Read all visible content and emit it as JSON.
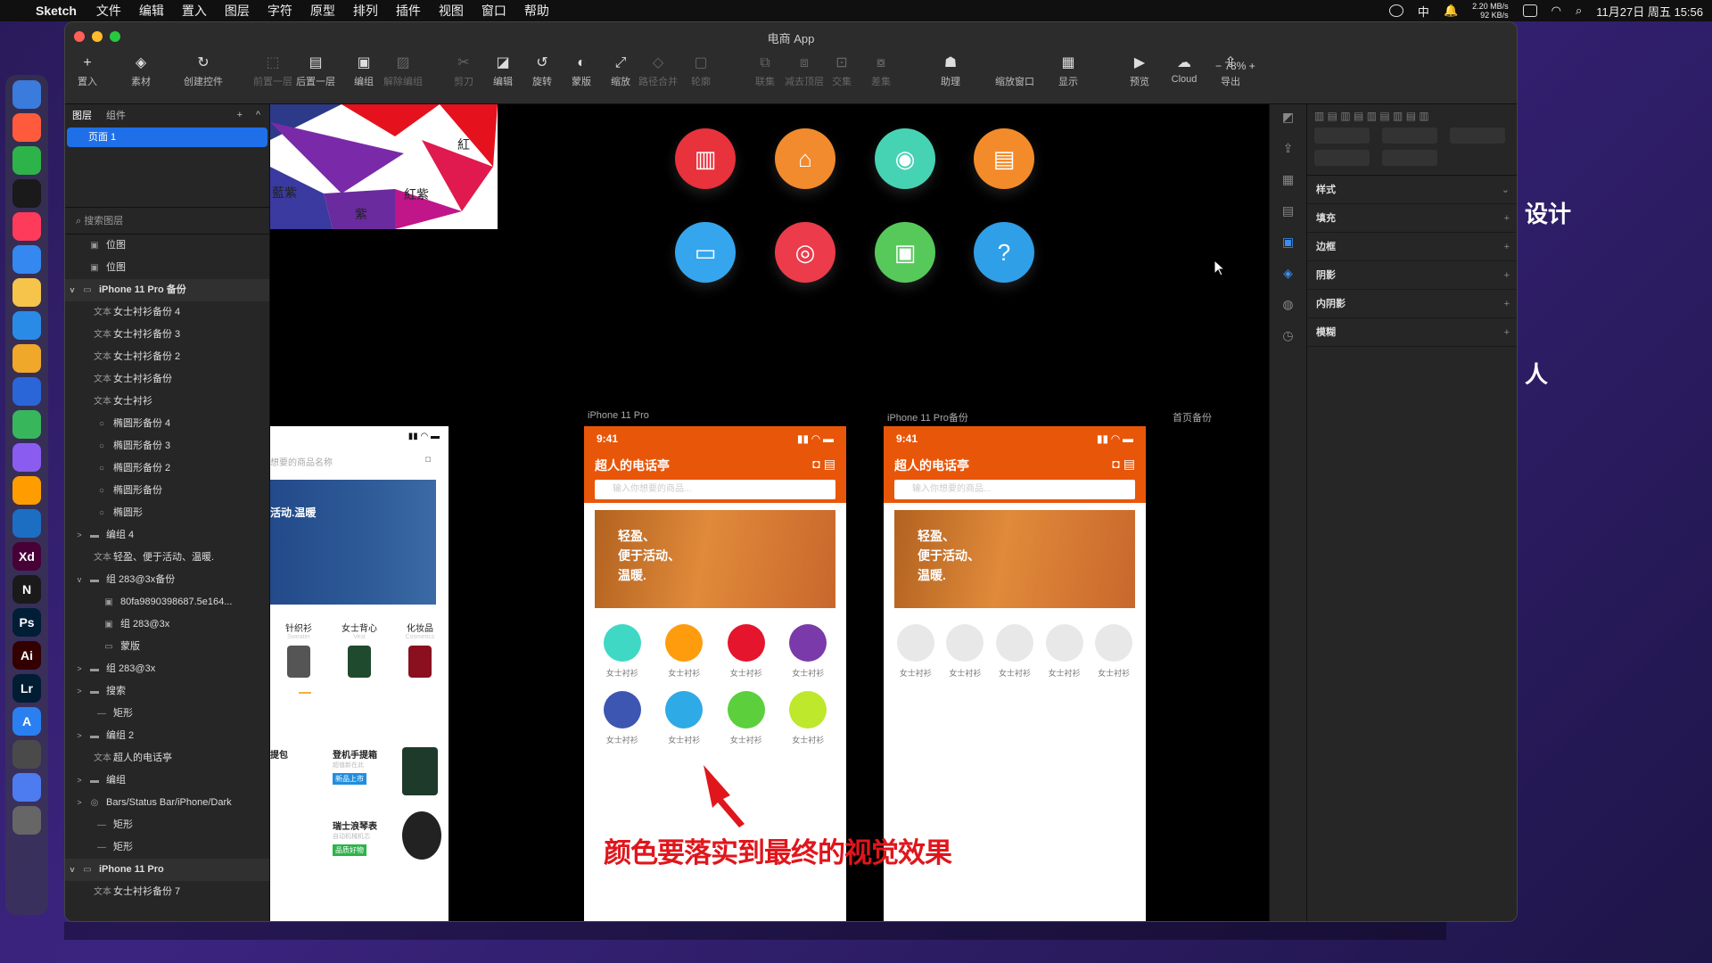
{
  "menubar": {
    "app": "Sketch",
    "items": [
      "文件",
      "编辑",
      "置入",
      "图层",
      "字符",
      "原型",
      "排列",
      "插件",
      "视图",
      "窗口",
      "帮助"
    ],
    "ime": "中",
    "net_up": "2.20 MB/s",
    "net_down": "92 KB/s",
    "datetime": "11月27日 周五 15:56"
  },
  "window": {
    "title": "电商 App"
  },
  "toolbar": {
    "items": [
      {
        "label": "置入",
        "icon": "+",
        "dim": false
      },
      {
        "label": "素材",
        "icon": "◈",
        "dim": false
      },
      {
        "label": "创建控件",
        "icon": "↻",
        "dim": false
      },
      {
        "label": "前置一层",
        "icon": "⬚",
        "dim": true
      },
      {
        "label": "后置一层",
        "icon": "▤",
        "dim": false
      },
      {
        "label": "编组",
        "icon": "▣",
        "dim": false
      },
      {
        "label": "解除编组",
        "icon": "▨",
        "dim": true
      },
      {
        "label": "剪刀",
        "icon": "✂",
        "dim": true
      },
      {
        "label": "编辑",
        "icon": "◪",
        "dim": false
      },
      {
        "label": "旋转",
        "icon": "↺",
        "dim": false
      },
      {
        "label": "蒙版",
        "icon": "◐",
        "dim": false
      },
      {
        "label": "缩放",
        "icon": "⤢",
        "dim": false
      },
      {
        "label": "路径合并",
        "icon": "◇",
        "dim": true
      },
      {
        "label": "轮廓",
        "icon": "▢",
        "dim": true
      },
      {
        "label": "联集",
        "icon": "⧉",
        "dim": true
      },
      {
        "label": "减去顶层",
        "icon": "⧈",
        "dim": true
      },
      {
        "label": "交集",
        "icon": "⊡",
        "dim": true
      },
      {
        "label": "差集",
        "icon": "⧇",
        "dim": true
      },
      {
        "label": "助理",
        "icon": "☗",
        "dim": false
      },
      {
        "label": "缩放窗口",
        "icon": "",
        "dim": false
      },
      {
        "label": "显示",
        "icon": "▦",
        "dim": false
      },
      {
        "label": "预览",
        "icon": "▶",
        "dim": false
      },
      {
        "label": "Cloud",
        "icon": "☁",
        "dim": false
      },
      {
        "label": "导出",
        "icon": "⇪",
        "dim": false
      }
    ],
    "zoom": "78%"
  },
  "layers": {
    "tabs": [
      "图层",
      "组件"
    ],
    "page": "页面 1",
    "search_placeholder": "搜索图层",
    "rows": [
      {
        "t": "位图",
        "ic": "▣",
        "a": "",
        "ind": 1,
        "h": false
      },
      {
        "t": "位图",
        "ic": "▣",
        "a": "",
        "ind": 1,
        "h": false
      },
      {
        "t": "iPhone 11 Pro 备份",
        "ic": "▭",
        "a": "v",
        "ind": 0,
        "h": true
      },
      {
        "t": "女士衬衫备份 4",
        "ic": "文本",
        "a": "",
        "ind": 2,
        "h": false
      },
      {
        "t": "女士衬衫备份 3",
        "ic": "文本",
        "a": "",
        "ind": 2,
        "h": false
      },
      {
        "t": "女士衬衫备份 2",
        "ic": "文本",
        "a": "",
        "ind": 2,
        "h": false
      },
      {
        "t": "女士衬衫备份",
        "ic": "文本",
        "a": "",
        "ind": 2,
        "h": false
      },
      {
        "t": "女士衬衫",
        "ic": "文本",
        "a": "",
        "ind": 2,
        "h": false
      },
      {
        "t": "椭圆形备份 4",
        "ic": "○",
        "a": "",
        "ind": 2,
        "h": false
      },
      {
        "t": "椭圆形备份 3",
        "ic": "○",
        "a": "",
        "ind": 2,
        "h": false
      },
      {
        "t": "椭圆形备份 2",
        "ic": "○",
        "a": "",
        "ind": 2,
        "h": false
      },
      {
        "t": "椭圆形备份",
        "ic": "○",
        "a": "",
        "ind": 2,
        "h": false
      },
      {
        "t": "椭圆形",
        "ic": "○",
        "a": "",
        "ind": 2,
        "h": false
      },
      {
        "t": "编组 4",
        "ic": "▬",
        "a": ">",
        "ind": 1,
        "h": false
      },
      {
        "t": "轻盈、便于活动、温暖.",
        "ic": "文本",
        "a": "",
        "ind": 2,
        "h": false
      },
      {
        "t": "组 283@3x备份",
        "ic": "▬",
        "a": "v",
        "ind": 1,
        "h": false
      },
      {
        "t": "80fa9890398687.5e164...",
        "ic": "▣",
        "a": "",
        "ind": 3,
        "h": false
      },
      {
        "t": "组 283@3x",
        "ic": "▣",
        "a": "",
        "ind": 3,
        "h": false
      },
      {
        "t": "蒙版",
        "ic": "▭",
        "a": "",
        "ind": 3,
        "h": false
      },
      {
        "t": "组 283@3x",
        "ic": "▬",
        "a": ">",
        "ind": 1,
        "h": false
      },
      {
        "t": "搜索",
        "ic": "▬",
        "a": ">",
        "ind": 1,
        "h": false
      },
      {
        "t": "矩形",
        "ic": "—",
        "a": "",
        "ind": 2,
        "h": false
      },
      {
        "t": "编组 2",
        "ic": "▬",
        "a": ">",
        "ind": 1,
        "h": false
      },
      {
        "t": "超人的电话亭",
        "ic": "文本",
        "a": "",
        "ind": 2,
        "h": false
      },
      {
        "t": "编组",
        "ic": "▬",
        "a": ">",
        "ind": 1,
        "h": false
      },
      {
        "t": "Bars/Status Bar/iPhone/Dark",
        "ic": "◎",
        "a": ">",
        "ind": 1,
        "h": false
      },
      {
        "t": "矩形",
        "ic": "—",
        "a": "",
        "ind": 2,
        "h": false
      },
      {
        "t": "矩形",
        "ic": "—",
        "a": "",
        "ind": 2,
        "h": false
      },
      {
        "t": "iPhone 11 Pro",
        "ic": "▭",
        "a": "v",
        "ind": 0,
        "h": true
      },
      {
        "t": "女士衬衫备份 7",
        "ic": "文本",
        "a": "",
        "ind": 2,
        "h": false
      }
    ]
  },
  "canvas": {
    "wheel": {
      "labels": [
        "紅",
        "紅紫",
        "紫",
        "藍紫"
      ]
    },
    "icons": [
      {
        "c": "#e8323c",
        "i": "▥",
        "name": "building-icon"
      },
      {
        "c": "#f28a2e",
        "i": "⌂",
        "name": "home-icon"
      },
      {
        "c": "#46d3b3",
        "i": "◉",
        "name": "location-icon"
      },
      {
        "c": "#f48b2a",
        "i": "▤",
        "name": "book-icon"
      },
      {
        "c": "#35a6ee",
        "i": "▭",
        "name": "monitor-icon"
      },
      {
        "c": "#ec3b4a",
        "i": "◎",
        "name": "search-icon"
      },
      {
        "c": "#56c95a",
        "i": "▣",
        "name": "bus-icon"
      },
      {
        "c": "#2f9fe8",
        "i": "?",
        "name": "help-icon"
      }
    ],
    "art1": "iPhone 11 Pro",
    "art2": "iPhone 11 Pro备份",
    "art3": "首页备份",
    "phone": {
      "time": "9:41",
      "title": "超人的电话亭",
      "search": "输入你想要的商品...",
      "banner": [
        "轻盈、",
        "便于活动、",
        "温暖."
      ]
    },
    "left_search": "想要的商品名称",
    "left_banner": "活动.温暖",
    "left_cats": [
      {
        "name": "针织衫",
        "en": "Sweater"
      },
      {
        "name": "女士背心",
        "en": "Vest"
      },
      {
        "name": "化妆品",
        "en": "Cosmetics"
      }
    ],
    "left_items": [
      {
        "name": "提包"
      },
      {
        "name": "登机手提箱",
        "sub": "超值新在此",
        "tag": "新品上市"
      },
      {
        "name": "瑞士浪琴表",
        "sub": "自动机械机芯",
        "tag": "品质好物"
      }
    ],
    "grid_label": "女士衬衫",
    "colors": [
      "#3fd8c4",
      "#ff9c0e",
      "#e4152c",
      "#7a3aa9",
      "#3d56b2",
      "#2eaae6",
      "#5ccf3c",
      "#bde82c"
    ],
    "annotation": "颜色要落实到最终的视觉效果"
  },
  "inspector": {
    "sections": [
      "样式",
      "填充",
      "边框",
      "阴影",
      "内阴影",
      "模糊"
    ]
  },
  "background_text": [
    "设计",
    "人"
  ]
}
